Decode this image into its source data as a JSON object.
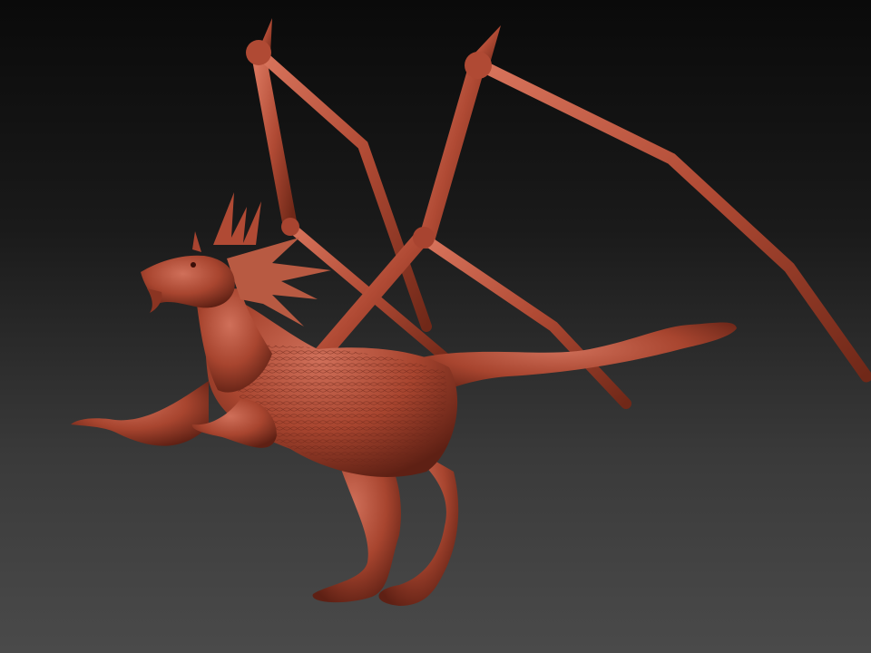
{
  "viewport": {
    "background_top": "#0a0a0a",
    "background_bottom": "#4a4a4a"
  },
  "model": {
    "material_color": "#b8503c",
    "shadow_color": "#6a2418",
    "highlight_color": "#e0806a"
  }
}
